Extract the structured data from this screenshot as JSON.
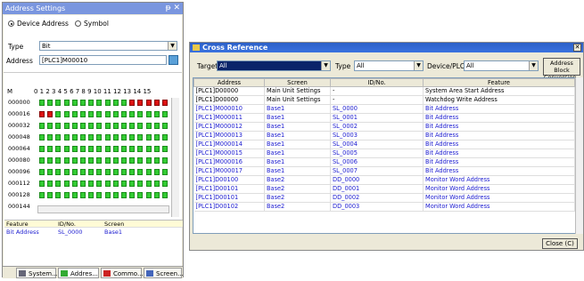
{
  "left_panel": {
    "title": "Address Settings",
    "pin_close": "ᵽ ✕",
    "radio_device": "Device Address",
    "radio_symbol": "Symbol",
    "type_label": "Type",
    "type_value": "Bit",
    "address_label": "Address",
    "address_value": "[PLC1]M00010",
    "grid_col_header": "M",
    "grid_cols": "0 1 2 3 4 5 6 7 8 9 10 11 12 13 14 15",
    "grid_rows": [
      "000000",
      "000016",
      "000032",
      "000048",
      "000064",
      "000080",
      "000096",
      "000112",
      "000128",
      "000144"
    ],
    "feature_headers": [
      "Feature",
      "ID/No.",
      "Screen"
    ],
    "feature_row": [
      "Bit Address",
      "SL_0000",
      "Base1"
    ],
    "tabs": [
      "System...",
      "Addres...",
      "Commo...",
      "Screen..."
    ]
  },
  "dialog": {
    "title": "Cross Reference",
    "close_x": "✕",
    "target_label": "Target",
    "target_value": "All",
    "type_label": "Type",
    "type_value": "All",
    "device_label": "Device/PLC",
    "device_value": "All",
    "abc_button": "Address Block Conversion...",
    "close_button": "Close (C)",
    "columns": [
      "Address",
      "Screen",
      "ID/No.",
      "Feature"
    ],
    "rows": [
      {
        "a": "[PLC1]D00000",
        "s": "Main Unit Settings",
        "i": "-",
        "f": "System Area Start Address",
        "blue": false
      },
      {
        "a": "[PLC1]D00000",
        "s": "Main Unit Settings",
        "i": "-",
        "f": "Watchdog Write Address",
        "blue": false
      },
      {
        "a": "[PLC1]M000010",
        "s": "Base1",
        "i": "SL_0000",
        "f": "Bit Address",
        "blue": true
      },
      {
        "a": "[PLC1]M000011",
        "s": "Base1",
        "i": "SL_0001",
        "f": "Bit Address",
        "blue": true
      },
      {
        "a": "[PLC1]M000012",
        "s": "Base1",
        "i": "SL_0002",
        "f": "Bit Address",
        "blue": true
      },
      {
        "a": "[PLC1]M000013",
        "s": "Base1",
        "i": "SL_0003",
        "f": "Bit Address",
        "blue": true
      },
      {
        "a": "[PLC1]M000014",
        "s": "Base1",
        "i": "SL_0004",
        "f": "Bit Address",
        "blue": true
      },
      {
        "a": "[PLC1]M000015",
        "s": "Base1",
        "i": "SL_0005",
        "f": "Bit Address",
        "blue": true
      },
      {
        "a": "[PLC1]M000016",
        "s": "Base1",
        "i": "SL_0006",
        "f": "Bit Address",
        "blue": true
      },
      {
        "a": "[PLC1]M000017",
        "s": "Base1",
        "i": "SL_0007",
        "f": "Bit Address",
        "blue": true
      },
      {
        "a": "[PLC1]D00100",
        "s": "Base2",
        "i": "DD_0000",
        "f": "Monitor Word Address",
        "blue": true
      },
      {
        "a": "[PLC1]D00101",
        "s": "Base2",
        "i": "DD_0001",
        "f": "Monitor Word Address",
        "blue": true
      },
      {
        "a": "[PLC1]D00101",
        "s": "Base2",
        "i": "DD_0002",
        "f": "Monitor Word Address",
        "blue": true
      },
      {
        "a": "[PLC1]D00102",
        "s": "Base2",
        "i": "DD_0003",
        "f": "Monitor Word Address",
        "blue": true
      }
    ]
  },
  "colors": {
    "bit_on": "#dd1111",
    "bit_off": "#33cc33",
    "link_blue": "#1a1ad0",
    "title_blue": "#2b5fc7"
  }
}
